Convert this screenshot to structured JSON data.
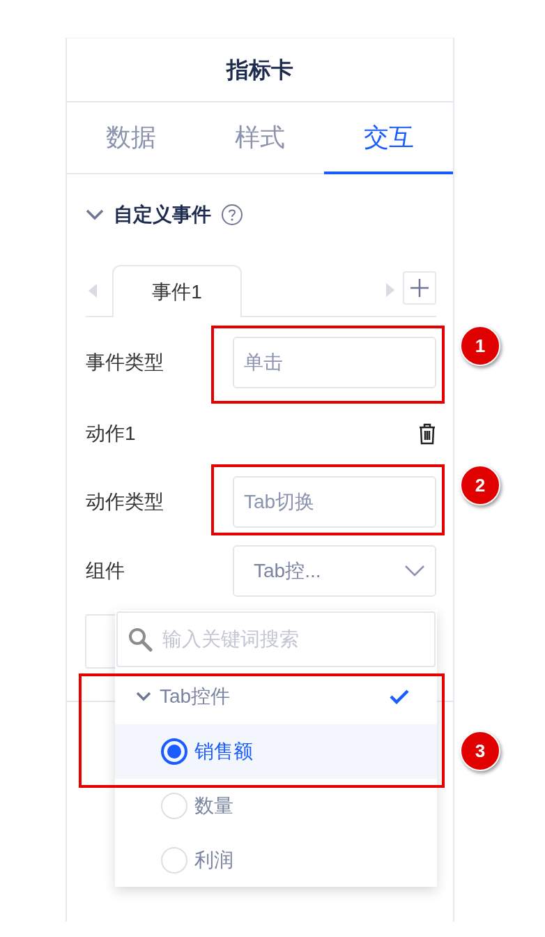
{
  "panel": {
    "title": "指标卡"
  },
  "tabs": [
    {
      "label": "数据",
      "selected": false
    },
    {
      "label": "样式",
      "selected": false
    },
    {
      "label": "交互",
      "selected": true
    }
  ],
  "section": {
    "title": "自定义事件",
    "expanded": true
  },
  "event_tabs": [
    {
      "label": "事件1",
      "selected": true
    }
  ],
  "event_form": {
    "event_type": {
      "label": "事件类型",
      "value": "单击"
    },
    "action": {
      "title": "动作1"
    },
    "action_type": {
      "label": "动作类型",
      "value": "Tab切换"
    },
    "component": {
      "label": "组件",
      "value": "Tab控..."
    }
  },
  "dropdown": {
    "search": {
      "placeholder": "输入关键词搜索"
    },
    "options": [
      {
        "label": "Tab控件",
        "expanded": true,
        "checked": true,
        "children": [
          {
            "label": "销售额",
            "selected": true
          },
          {
            "label": "数量",
            "selected": false
          },
          {
            "label": "利润",
            "selected": false
          }
        ]
      }
    ]
  },
  "annotations": [
    {
      "label": "1"
    },
    {
      "label": "2"
    },
    {
      "label": "3"
    }
  ]
}
